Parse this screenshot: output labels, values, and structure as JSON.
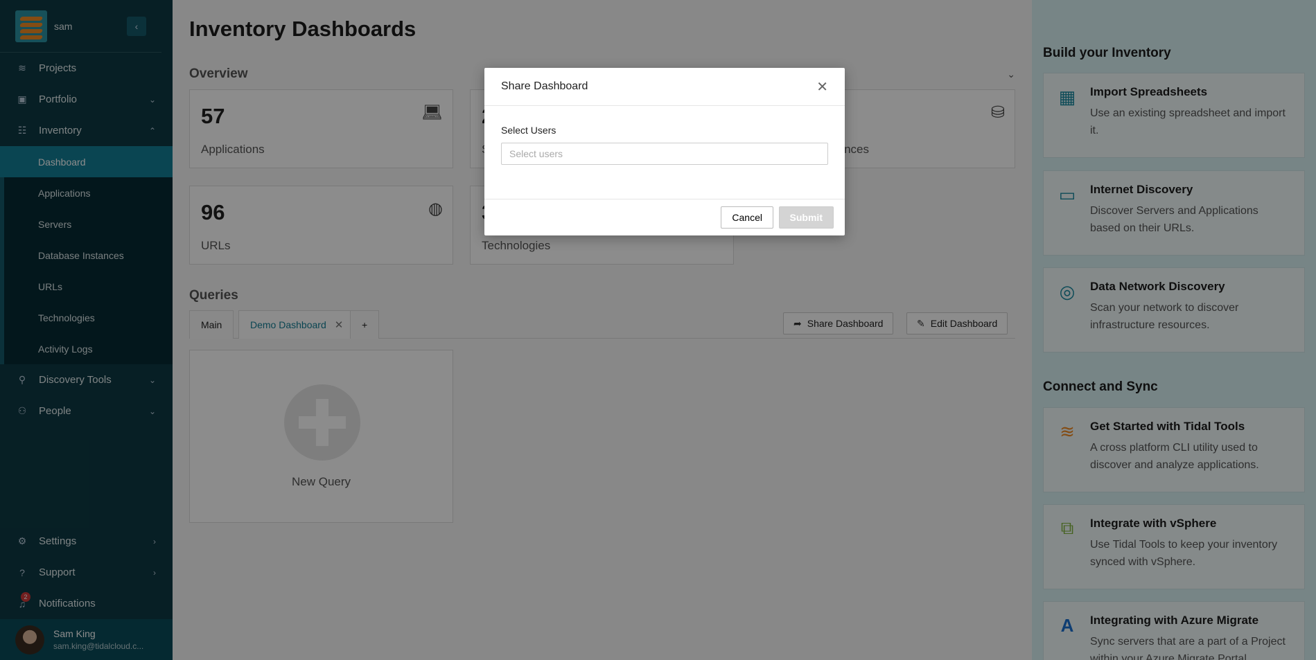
{
  "sidebar": {
    "brand_name": "sam",
    "collapse_icon": "chevron-left-icon",
    "items": [
      {
        "label": "Projects",
        "icon": "layers-icon"
      },
      {
        "label": "Portfolio",
        "icon": "briefcase-icon"
      },
      {
        "label": "Inventory",
        "icon": "inventory-icon"
      }
    ],
    "inventory_sub": [
      {
        "label": "Dashboard"
      },
      {
        "label": "Applications"
      },
      {
        "label": "Servers"
      },
      {
        "label": "Database Instances"
      },
      {
        "label": "URLs"
      },
      {
        "label": "Technologies"
      },
      {
        "label": "Activity Logs"
      }
    ],
    "more_items": [
      {
        "label": "Discovery Tools",
        "icon": "search-icon"
      },
      {
        "label": "People",
        "icon": "people-icon"
      }
    ],
    "bottom_items": [
      {
        "label": "Settings",
        "icon": "gear-icon"
      },
      {
        "label": "Support",
        "icon": "help-icon"
      },
      {
        "label": "Notifications",
        "icon": "bell-icon",
        "badge": "2"
      }
    ],
    "user": {
      "name": "Sam King",
      "email": "sam.king@tidalcloud.c..."
    }
  },
  "main": {
    "title": "Inventory Dashboards",
    "overview_title": "Overview",
    "cards": [
      {
        "value": "57",
        "label": "Applications",
        "icon": "laptop-code-icon"
      },
      {
        "value": "2",
        "label": "S",
        "icon": "server-icon"
      },
      {
        "value": "",
        "label": "nces",
        "icon": "database-icon"
      },
      {
        "value": "96",
        "label": "URLs",
        "icon": "globe-icon"
      },
      {
        "value": "3",
        "label": "Technologies",
        "icon": "tech-icon"
      }
    ],
    "queries_title": "Queries",
    "tabs": [
      {
        "label": "Main"
      },
      {
        "label": "Demo Dashboard",
        "close": "✕"
      },
      {
        "label": "+"
      }
    ],
    "share_button": "Share Dashboard",
    "edit_button": "Edit Dashboard",
    "new_query_label": "New Query"
  },
  "right_panel": {
    "build_heading": "Build your Inventory",
    "build_cards": [
      {
        "title": "Import Spreadsheets",
        "desc": "Use an existing spreadsheet and import it.",
        "icon": "spreadsheet-icon"
      },
      {
        "title": "Internet Discovery",
        "desc": "Discover Servers and Applications based on their URLs.",
        "icon": "browser-window-icon"
      },
      {
        "title": "Data Network Discovery",
        "desc": "Scan your network to discover infrastructure resources.",
        "icon": "radar-icon"
      }
    ],
    "sync_heading": "Connect and Sync",
    "sync_cards": [
      {
        "title": "Get Started with Tidal Tools",
        "desc": "A cross platform CLI utility used to discover and analyze applications.",
        "icon": "tidal-logo-icon"
      },
      {
        "title": "Integrate with vSphere",
        "desc": "Use Tidal Tools to keep your inventory synced with vSphere.",
        "icon": "vsphere-icon"
      },
      {
        "title": "Integrating with Azure Migrate",
        "desc": "Sync servers that are a part of a Project within your Azure Migrate Portal.",
        "icon": "azure-icon"
      }
    ]
  },
  "modal": {
    "title": "Share Dashboard",
    "field_label": "Select Users",
    "placeholder": "Select users",
    "cancel": "Cancel",
    "submit": "Submit"
  },
  "colors": {
    "sidebar_bg": "#0d3a44",
    "active_item": "#137e95",
    "accent": "#1b8aa1",
    "right_panel_bg": "#d9f2f5"
  }
}
